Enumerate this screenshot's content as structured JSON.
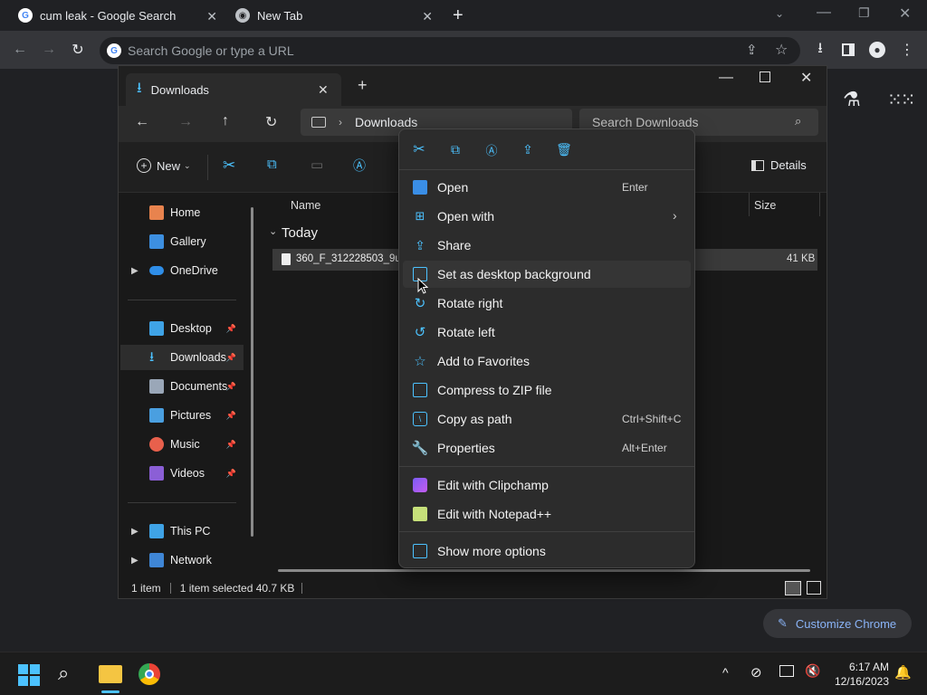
{
  "browser": {
    "tabs": [
      {
        "label": "cum leak - Google Search",
        "favicon": "google-icon"
      },
      {
        "label": "New Tab",
        "favicon": "chrome-icon"
      }
    ],
    "new_tab_label": "+",
    "omnibox_placeholder": "Search Google or type a URL",
    "customize_label": "Customize Chrome"
  },
  "explorer": {
    "tab_title": "Downloads",
    "address_location": "Downloads",
    "search_placeholder": "Search Downloads",
    "new_label": "New",
    "details_label": "Details",
    "sidebar": {
      "home": "Home",
      "gallery": "Gallery",
      "onedrive": "OneDrive",
      "desktop": "Desktop",
      "downloads": "Downloads",
      "documents": "Documents",
      "pictures": "Pictures",
      "music": "Music",
      "videos": "Videos",
      "thispc": "This PC",
      "network": "Network"
    },
    "columns": {
      "name": "Name",
      "size": "Size"
    },
    "group_label": "Today",
    "file": {
      "name": "360_F_312228503_9ue",
      "size": "41 KB"
    },
    "status": {
      "count": "1 item",
      "selected": "1 item selected  40.7 KB"
    }
  },
  "context_menu": {
    "items": [
      {
        "label": "Open",
        "accel": "Enter"
      },
      {
        "label": "Open with",
        "accel": ""
      },
      {
        "label": "Share",
        "accel": ""
      },
      {
        "label": "Set as desktop background",
        "accel": ""
      },
      {
        "label": "Rotate right",
        "accel": ""
      },
      {
        "label": "Rotate left",
        "accel": ""
      },
      {
        "label": "Add to Favorites",
        "accel": ""
      },
      {
        "label": "Compress to ZIP file",
        "accel": ""
      },
      {
        "label": "Copy as path",
        "accel": "Ctrl+Shift+C"
      },
      {
        "label": "Properties",
        "accel": "Alt+Enter"
      },
      {
        "label": "Edit with Clipchamp",
        "accel": ""
      },
      {
        "label": "Edit with Notepad++",
        "accel": ""
      },
      {
        "label": "Show more options",
        "accel": ""
      }
    ]
  },
  "taskbar": {
    "time": "6:17 AM",
    "date": "12/16/2023"
  },
  "colors": {
    "accent": "#4cc2ff",
    "folder": "#f4c542"
  }
}
